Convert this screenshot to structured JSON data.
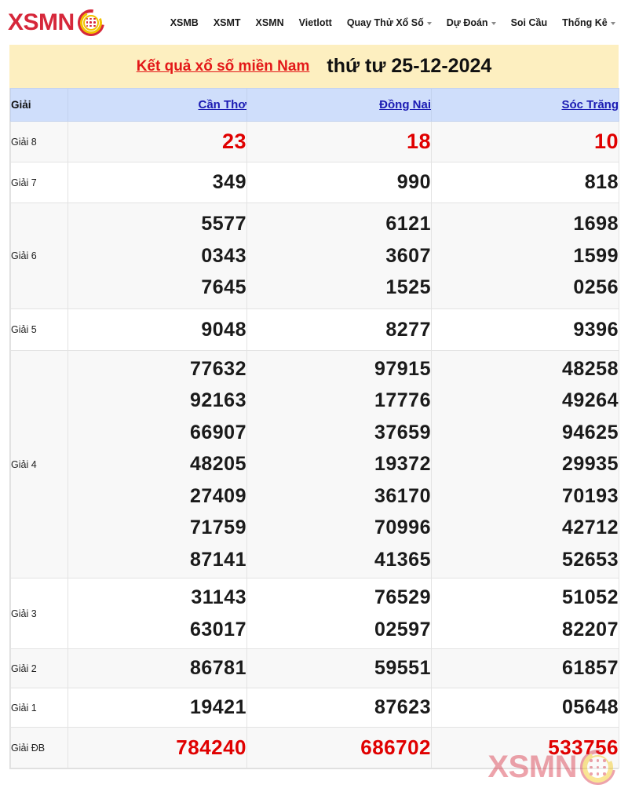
{
  "site": {
    "logo_text": "XSMN",
    "logo_icon": "lottery-ball-icon"
  },
  "nav": {
    "items": [
      {
        "label": "XSMB",
        "has_dropdown": false
      },
      {
        "label": "XSMT",
        "has_dropdown": false
      },
      {
        "label": "XSMN",
        "has_dropdown": false
      },
      {
        "label": "Vietlott",
        "has_dropdown": false
      },
      {
        "label": "Quay Thử Xổ Số",
        "has_dropdown": true
      },
      {
        "label": "Dự Đoán",
        "has_dropdown": true
      },
      {
        "label": "Soi Cầu",
        "has_dropdown": false
      },
      {
        "label": "Thống Kê",
        "has_dropdown": true
      }
    ]
  },
  "banner": {
    "link_text": "Kết quả xổ số miền Nam",
    "date_text": "thứ tư 25-12-2024",
    "background": "#fdefc0",
    "link_color": "#e31818"
  },
  "table": {
    "header": {
      "prize_column": "Giải",
      "provinces": [
        "Cần Thơ",
        "Đồng Nai",
        "Sóc Trăng"
      ],
      "background": "#cfdefb",
      "link_color": "#1b1bb3"
    },
    "rows": [
      {
        "prize": "Giải 8",
        "highlight": "red",
        "shaded": true,
        "values": [
          [
            "23"
          ],
          [
            "18"
          ],
          [
            "10"
          ]
        ]
      },
      {
        "prize": "Giải 7",
        "highlight": "black",
        "shaded": false,
        "values": [
          [
            "349"
          ],
          [
            "990"
          ],
          [
            "818"
          ]
        ]
      },
      {
        "prize": "Giải 6",
        "highlight": "black",
        "shaded": true,
        "values": [
          [
            "5577",
            "0343",
            "7645"
          ],
          [
            "6121",
            "3607",
            "1525"
          ],
          [
            "1698",
            "1599",
            "0256"
          ]
        ]
      },
      {
        "prize": "Giải 5",
        "highlight": "black",
        "shaded": false,
        "values": [
          [
            "9048"
          ],
          [
            "8277"
          ],
          [
            "9396"
          ]
        ]
      },
      {
        "prize": "Giải 4",
        "highlight": "black",
        "shaded": true,
        "values": [
          [
            "77632",
            "92163",
            "66907",
            "48205",
            "27409",
            "71759",
            "87141"
          ],
          [
            "97915",
            "17776",
            "37659",
            "19372",
            "36170",
            "70996",
            "41365"
          ],
          [
            "48258",
            "49264",
            "94625",
            "29935",
            "70193",
            "42712",
            "52653"
          ]
        ]
      },
      {
        "prize": "Giải 3",
        "highlight": "black",
        "shaded": false,
        "values": [
          [
            "31143",
            "63017"
          ],
          [
            "76529",
            "02597"
          ],
          [
            "51052",
            "82207"
          ]
        ]
      },
      {
        "prize": "Giải 2",
        "highlight": "black",
        "shaded": true,
        "values": [
          [
            "86781"
          ],
          [
            "59551"
          ],
          [
            "61857"
          ]
        ]
      },
      {
        "prize": "Giải 1",
        "highlight": "black",
        "shaded": false,
        "values": [
          [
            "19421"
          ],
          [
            "87623"
          ],
          [
            "05648"
          ]
        ]
      },
      {
        "prize": "Giải ĐB",
        "highlight": "red",
        "shaded": true,
        "values": [
          [
            "784240"
          ],
          [
            "686702"
          ],
          [
            "533756"
          ]
        ]
      }
    ]
  },
  "watermark": {
    "text": "XSMN",
    "icon": "lottery-ball-icon"
  },
  "colors": {
    "brand_red": "#d6273a",
    "number_red": "#e00000",
    "number_black": "#1a1a1a",
    "row_shaded": "#f8f8f8",
    "row_plain": "#ffffff"
  }
}
